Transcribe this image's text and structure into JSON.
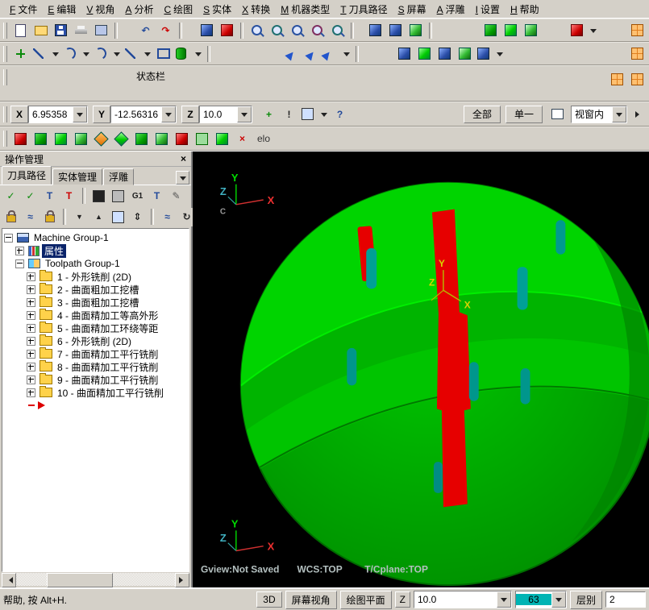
{
  "colors": {
    "model_green": "#00cc00",
    "slot_red": "#e60000",
    "slot_teal": "#00a096",
    "selection_bg": "#0a246a",
    "level_swatch": "#00b4b4"
  },
  "menu": {
    "items": [
      {
        "key": "F",
        "label": "文件"
      },
      {
        "key": "E",
        "label": "编辑"
      },
      {
        "key": "V",
        "label": "视角"
      },
      {
        "key": "A",
        "label": "分析"
      },
      {
        "key": "C",
        "label": "绘图"
      },
      {
        "key": "S",
        "label": "实体"
      },
      {
        "key": "X",
        "label": "转换"
      },
      {
        "key": "M",
        "label": "机器类型"
      },
      {
        "key": "T",
        "label": "刀具路径"
      },
      {
        "key": "S",
        "label": "屏幕"
      },
      {
        "key": "A",
        "label": "浮雕"
      },
      {
        "key": "I",
        "label": "设置"
      },
      {
        "key": "H",
        "label": "帮助"
      }
    ]
  },
  "icons": {
    "undo": "↶",
    "redo": "↷",
    "warn": "!",
    "help": "?",
    "plus": "+",
    "check": "✓",
    "tee": "T",
    "g1": "G1",
    "pencil": "✎",
    "down": "▼",
    "up": "▲",
    "swap": "⇕",
    "waves": "≈",
    "refresh": "↻",
    "close": "×"
  },
  "status_label": "状态栏",
  "quick_label": "elo",
  "coord": {
    "x_label": "X",
    "x_value": "6.95358",
    "y_label": "Y",
    "y_value": "-12.56316",
    "z_label": "Z",
    "z_value": "10.0"
  },
  "view_controls": {
    "all": "全部",
    "single": "单一",
    "window": "视窗内"
  },
  "ops": {
    "title": "操作管理",
    "tabs": {
      "toolpaths": "刀具路径",
      "solids": "实体管理",
      "art": "浮雕"
    },
    "tree": {
      "machine_group": "Machine Group-1",
      "properties": "属性",
      "toolpath_group": "Toolpath Group-1",
      "operations": [
        "1 - 外形铣削 (2D)",
        "2 - 曲面粗加工挖槽",
        "3 - 曲面粗加工挖槽",
        "4 - 曲面精加工等高外形",
        "5 - 曲面精加工环绕等距",
        "6 - 外形铣削 (2D)",
        "7 - 曲面精加工平行铣削",
        "8 - 曲面精加工平行铣削",
        "9 - 曲面精加工平行铣削",
        "10 - 曲面精加工平行铣削"
      ]
    }
  },
  "viewport": {
    "status": {
      "gview": "Gview:Not Saved",
      "wcs": "WCS:TOP",
      "cplane": "T/Cplane:TOP"
    },
    "axes": {
      "x": "X",
      "y": "Y",
      "z": "Z",
      "c": "C"
    }
  },
  "statusbar": {
    "help": "帮助, 按 Alt+H.",
    "mode": "3D",
    "screen_view": "屏幕视角",
    "draw_plane": "绘图平面",
    "z_label": "Z",
    "z_value": "10.0",
    "color_value": "63",
    "level_label": "层别",
    "level_value": "2"
  }
}
